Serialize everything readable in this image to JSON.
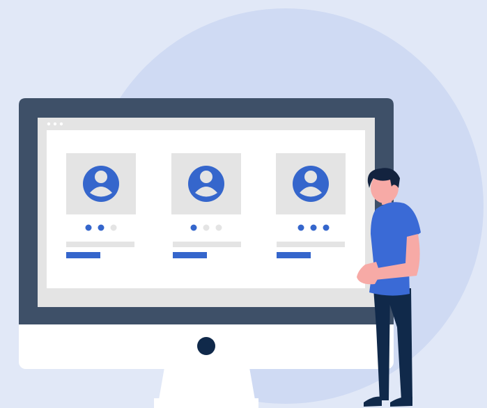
{
  "colors": {
    "background": "#e1e8f7",
    "circle": "#cfdaf3",
    "monitor_bezel": "#3e5068",
    "monitor_chin": "#ffffff",
    "screen_frame": "#e4e4e4",
    "screen_content": "#ffffff",
    "card_bg": "#e4e4e4",
    "accent": "#3566cc",
    "dot_inactive": "#e4e4e4",
    "bar_gray": "#e4e4e4",
    "skin": "#f7aaa6",
    "hair": "#13233f",
    "shirt": "#3a6ad6",
    "pants": "#10294a"
  },
  "window_dots": 3,
  "cards": [
    {
      "icon": "user-avatar-icon",
      "rating": 2,
      "rating_max": 3
    },
    {
      "icon": "user-avatar-icon",
      "rating": 1,
      "rating_max": 3
    },
    {
      "icon": "user-avatar-icon",
      "rating": 3,
      "rating_max": 3
    }
  ]
}
